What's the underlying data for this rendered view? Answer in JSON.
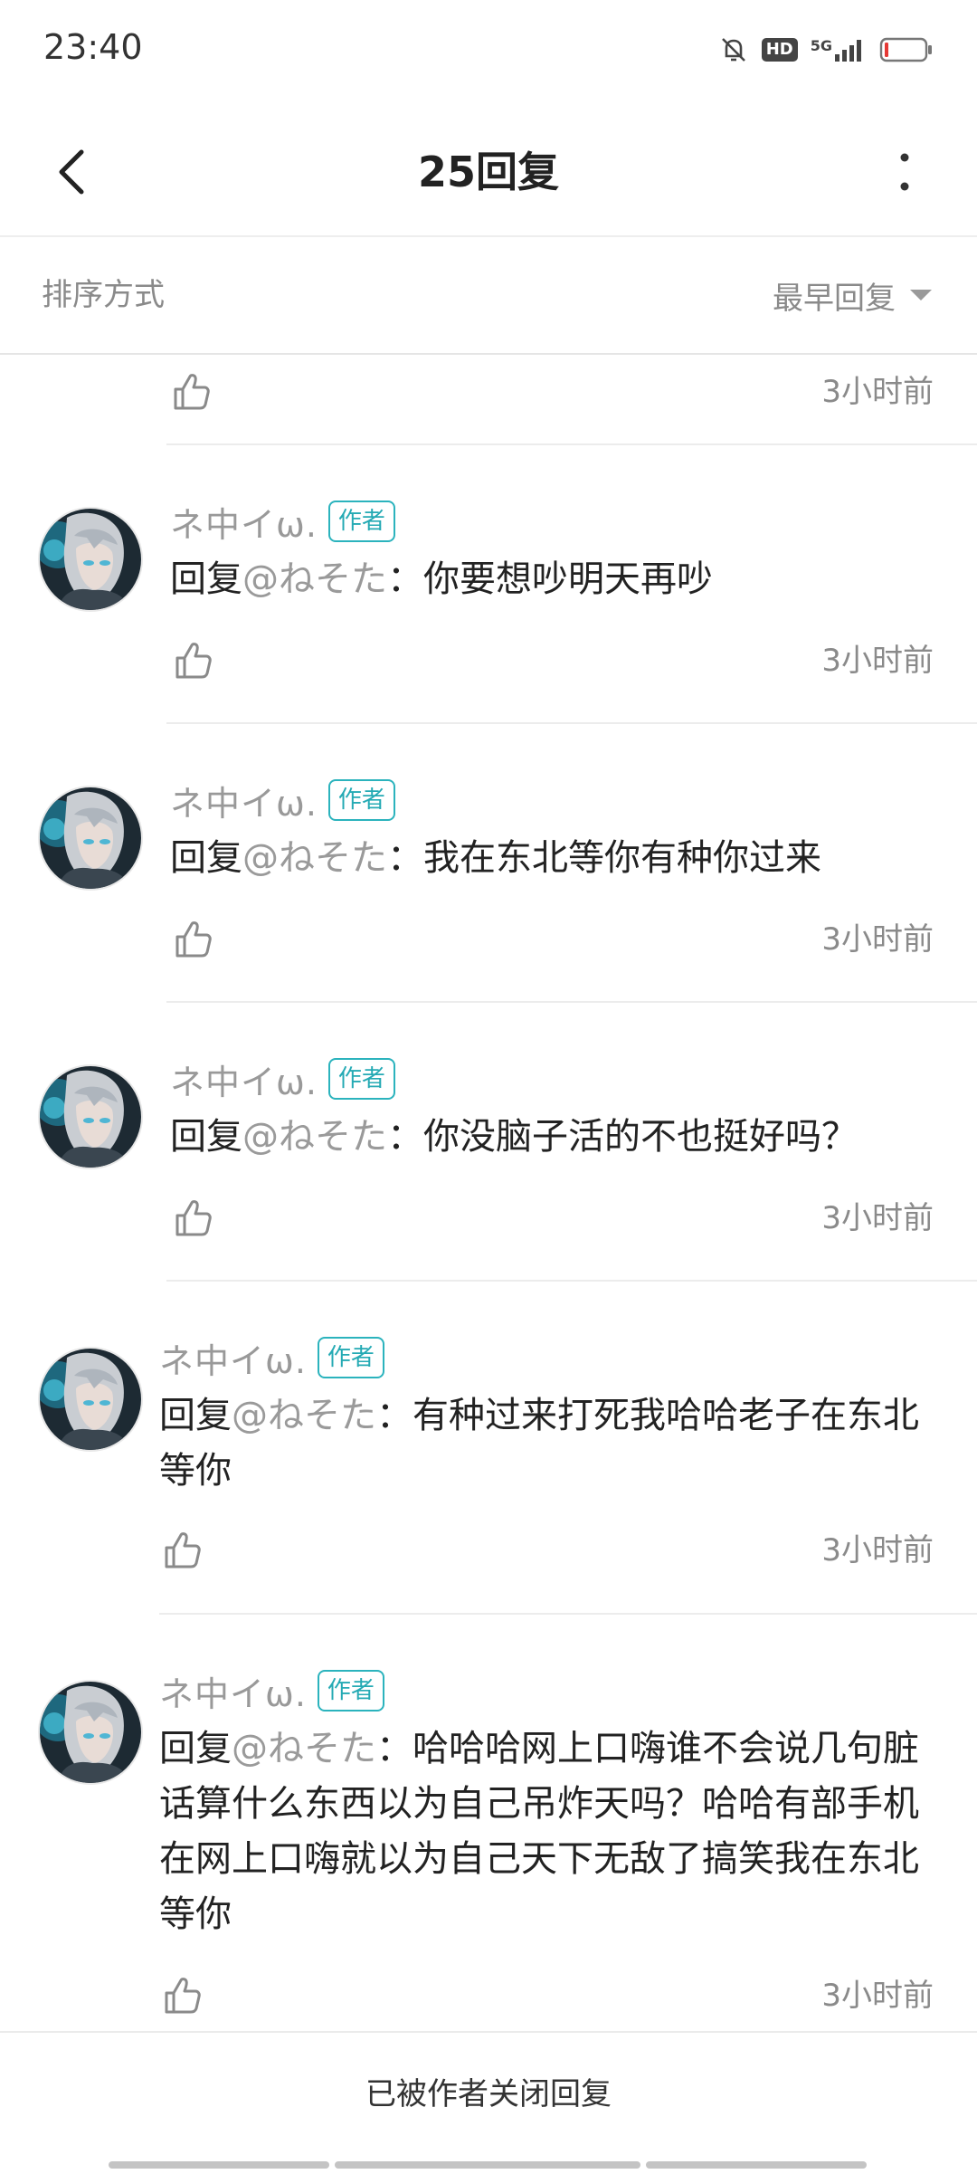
{
  "status_bar": {
    "time": "23:40",
    "hd": "HD",
    "network": "5G"
  },
  "header": {
    "title": "25回复"
  },
  "sort": {
    "label": "排序方式",
    "value": "最早回复"
  },
  "partial_reply": {
    "time": "3小时前"
  },
  "replies": [
    {
      "name": "ネ中イω.",
      "badge": "作者",
      "prefix": "回复",
      "mention": "@ねそた",
      "colon": "：",
      "text": "你要想吵明天再吵",
      "time": "3小时前"
    },
    {
      "name": "ネ中イω.",
      "badge": "作者",
      "prefix": "回复",
      "mention": "@ねそた",
      "colon": "：",
      "text": "我在东北等你有种你过来",
      "time": "3小时前"
    },
    {
      "name": "ネ中イω.",
      "badge": "作者",
      "prefix": "回复",
      "mention": "@ねそた",
      "colon": "：",
      "text": "你没脑子活的不也挺好吗？",
      "time": "3小时前"
    },
    {
      "name": "ネ中イω.",
      "badge": "作者",
      "prefix": "回复",
      "mention": "@ねそた",
      "colon": "：",
      "text": "有种过来打死我哈哈老子在东北等你",
      "time": "3小时前"
    },
    {
      "name": "ネ中イω.",
      "badge": "作者",
      "prefix": "回复",
      "mention": "@ねそた",
      "colon": "：",
      "text": "哈哈哈网上口嗨谁不会说几句脏话算什么东西以为自己吊炸天吗？哈哈有部手机在网上口嗨就以为自己天下无敌了搞笑我在东北等你",
      "time": "3小时前"
    }
  ],
  "footer": {
    "text": "已被作者关闭回复"
  },
  "colors": {
    "accent": "#2bb3bd",
    "muted": "#8a8a8a",
    "text": "#222222"
  },
  "icons": [
    "back-arrow-icon",
    "more-vertical-icon",
    "dropdown-arrow-icon",
    "thumbs-up-icon",
    "mute-bell-icon",
    "signal-icon",
    "battery-icon"
  ]
}
